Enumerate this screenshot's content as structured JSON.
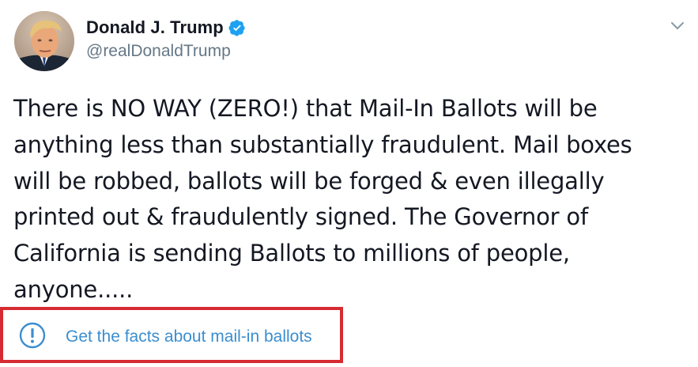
{
  "tweet": {
    "author": {
      "display_name": "Donald J. Trump",
      "handle": "@realDonaldTrump",
      "verified": true
    },
    "text_lines": [
      "There is NO WAY (ZERO!) that Mail-In Ballots will be",
      "anything less than substantially fraudulent. Mail boxes",
      "will be robbed, ballots will be forged & even illegally",
      "printed out & fraudulently signed. The Governor of",
      "California is sending Ballots to millions of people,",
      "anyone....."
    ],
    "factcheck": {
      "label": "Get the facts about mail-in ballots"
    }
  },
  "colors": {
    "link_blue": "#3b8ed0",
    "verified_blue": "#1da1f2",
    "handle_grey": "#657786",
    "highlight_red": "#d62b32"
  },
  "icons": {
    "verified": "verified-badge-icon",
    "caret": "chevron-down-icon",
    "factcheck": "exclamation-circle-icon"
  }
}
